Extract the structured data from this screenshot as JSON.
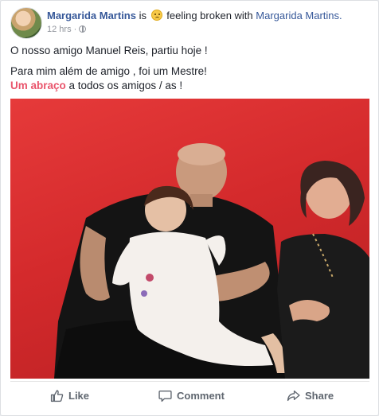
{
  "post": {
    "author": "Margarida Martins",
    "is_text": "is",
    "feeling_text": "feeling broken with",
    "tagged": "Margarida Martins.",
    "time": "12 hrs",
    "separator": "·",
    "line1": "O nosso amigo Manuel Reis, partiu hoje !",
    "line2": "Para mim além de amigo , foi um Mestre!",
    "line3_highlight": "Um abraço",
    "line3_rest": " a todos os amigos / as !"
  },
  "actions": {
    "like": "Like",
    "comment": "Comment",
    "share": "Share"
  },
  "icons": {
    "emoji": "sad-face-icon",
    "privacy": "globe-icon",
    "like": "thumbs-up-icon",
    "comment": "speech-bubble-icon",
    "share": "share-arrow-icon"
  },
  "colors": {
    "link": "#365899",
    "highlight": "#e9546b",
    "action_text": "#606770",
    "photo_background": "#d42a2c"
  }
}
